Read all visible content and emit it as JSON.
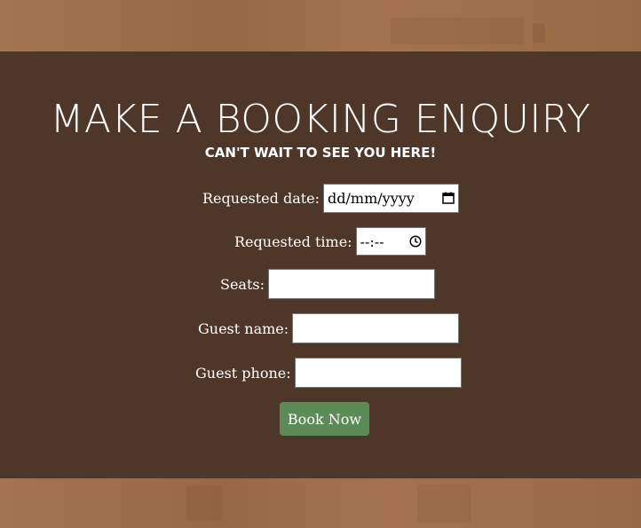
{
  "heading": {
    "title": "MAKE A BOOKING ENQUIRY",
    "subtitle": "CAN'T WAIT TO SEE YOU HERE!"
  },
  "form": {
    "date_label": "Requested date:",
    "date_value": "dd/mm/yyyy",
    "time_label": "Requested time:",
    "time_value": "--:--",
    "seats_label": "Seats:",
    "seats_value": "",
    "guest_name_label": "Guest name:",
    "guest_name_value": "",
    "guest_phone_label": "Guest phone:",
    "guest_phone_value": "",
    "submit_label": "Book Now"
  },
  "colors": {
    "panel": "#4e3628",
    "background": "#a06d48",
    "button": "#5d8b57",
    "text": "#ffffff"
  },
  "icons": {
    "date": "calendar-icon",
    "time": "clock-icon"
  }
}
